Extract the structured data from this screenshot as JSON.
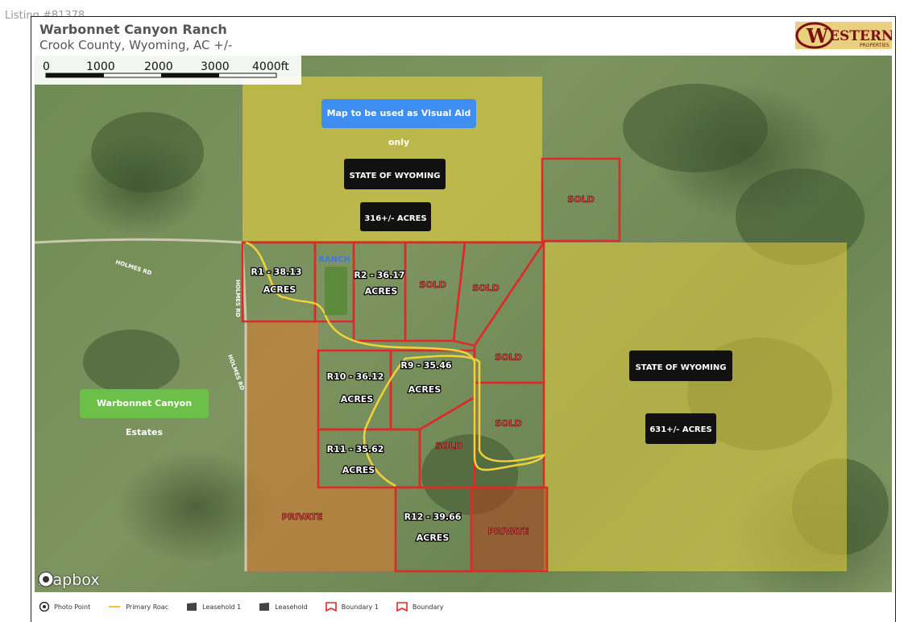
{
  "listing": {
    "id_label": "Listing #81378"
  },
  "header": {
    "title": "Warbonnet Canyon Ranch",
    "subtitle": "Crook County, Wyoming,  AC +/-",
    "logo_text": "ESTERN",
    "logo_sub": "PROPERTIES",
    "logo_initial": "W"
  },
  "map": {
    "visual_aid": "Map to be used as Visual Aid only",
    "estates": "Warbonnet Canyon Estates",
    "state_north": "STATE OF WYOMING",
    "state_north_acres": "316+/- ACRES",
    "state_east": "STATE OF WYOMING",
    "state_east_acres": "631+/- ACRES",
    "road_holmes": "HOLMES RD",
    "ranch": "RANCH",
    "parcels": {
      "r1": "R1 - 38.13",
      "r2": "R2 - 36.17",
      "r9": "R9 - 35.46",
      "r10": "R10 - 36.12",
      "r11": "R11 - 35.62",
      "r12": "R12 - 39.66",
      "acres": "ACRES"
    },
    "sold": "SOLD",
    "private": "PRIVATE",
    "colors": {
      "state": "#e8d040",
      "private": "#e07a30",
      "boundary": "#e02828",
      "road": "#f2d23a"
    }
  },
  "attribution": {
    "mapbox": "mapbox"
  },
  "scale": {
    "ticks": [
      "0",
      "1000",
      "2000",
      "3000",
      "4000ft"
    ]
  },
  "legend": {
    "items": [
      {
        "icon": "camera-icon",
        "label": "Photo Point"
      },
      {
        "icon": "line-icon",
        "label": "Primary Roac"
      },
      {
        "icon": "leasehold-icon",
        "label": "Leasehold 1"
      },
      {
        "icon": "leasehold-icon",
        "label": "Leasehold"
      },
      {
        "icon": "boundary-icon",
        "label": "Boundary 1"
      },
      {
        "icon": "boundary-icon",
        "label": "Boundary"
      }
    ]
  }
}
